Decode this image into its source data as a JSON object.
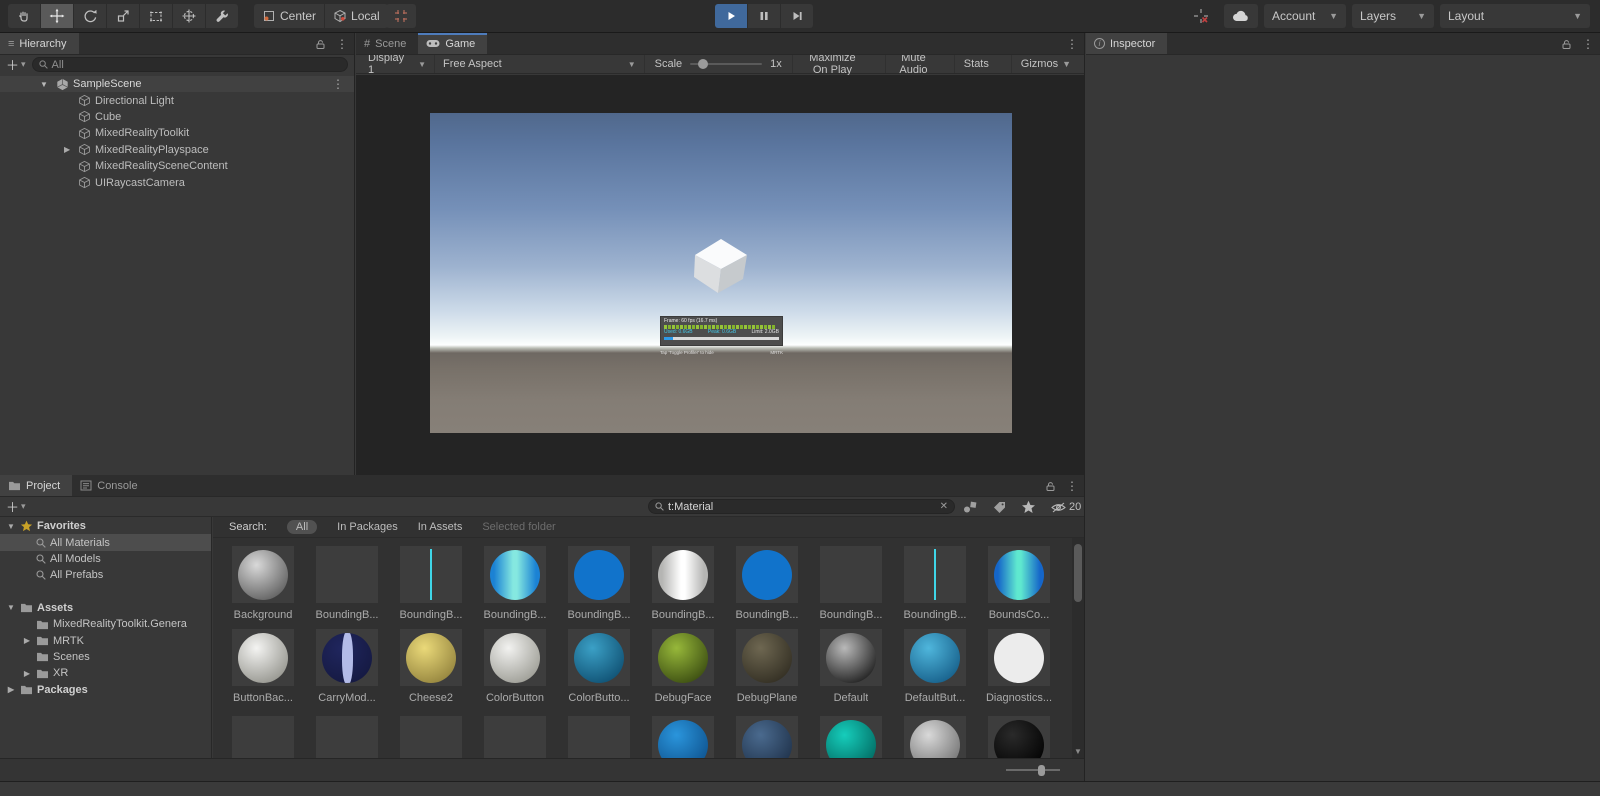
{
  "topbar": {
    "pivot": "Center",
    "space": "Local",
    "account": "Account",
    "layers": "Layers",
    "layout": "Layout"
  },
  "hierarchy": {
    "title": "Hierarchy",
    "search_placeholder": "All",
    "scene_name": "SampleScene",
    "items": [
      {
        "label": "Directional Light",
        "expandable": false
      },
      {
        "label": "Cube",
        "expandable": false
      },
      {
        "label": "MixedRealityToolkit",
        "expandable": false
      },
      {
        "label": "MixedRealityPlayspace",
        "expandable": true
      },
      {
        "label": "MixedRealitySceneContent",
        "expandable": false
      },
      {
        "label": "UIRaycastCamera",
        "expandable": false
      }
    ]
  },
  "game": {
    "scene_tab": "Scene",
    "game_tab": "Game",
    "display": "Display 1",
    "aspect": "Free Aspect",
    "scale_label": "Scale",
    "scale_value": "1x",
    "buttons": [
      {
        "label": "Maximize On Play",
        "dropdown": false
      },
      {
        "label": "Mute Audio",
        "dropdown": false
      },
      {
        "label": "Stats",
        "dropdown": false
      },
      {
        "label": "Gizmos",
        "dropdown": true
      }
    ],
    "profiler": {
      "title": "Frame: 60 fps (16.7 ms)",
      "used_label": "Used: 0.6GB",
      "peak_label": "Peak: 0.6GB",
      "limit_label": "Limit: 2.0GB",
      "caption_left": "Tap 'Toggle Profiler' to hide",
      "caption_right": "MRTK"
    }
  },
  "inspector": {
    "title": "Inspector"
  },
  "project": {
    "project_tab": "Project",
    "console_tab": "Console",
    "search_value": "t:Material",
    "hidden_count": "20",
    "filter_label": "Search:",
    "scopes": [
      {
        "label": "All",
        "active": true,
        "disabled": false
      },
      {
        "label": "In Packages",
        "active": false,
        "disabled": false
      },
      {
        "label": "In Assets",
        "active": false,
        "disabled": false
      },
      {
        "label": "Selected folder",
        "active": false,
        "disabled": true
      }
    ],
    "favorites_label": "Favorites",
    "favorites": [
      {
        "label": "All Materials",
        "selected": true
      },
      {
        "label": "All Models",
        "selected": false
      },
      {
        "label": "All Prefabs",
        "selected": false
      }
    ],
    "assets_label": "Assets",
    "asset_folders": [
      {
        "label": "MixedRealityToolkit.Genera",
        "expandable": false
      },
      {
        "label": "MRTK",
        "expandable": true
      },
      {
        "label": "Scenes",
        "expandable": false
      },
      {
        "label": "XR",
        "expandable": true
      }
    ],
    "packages_label": "Packages",
    "material_rows": [
      [
        {
          "label": "Background",
          "kind": "sphere",
          "c1": "#d9d9d9",
          "c2": "#585858"
        },
        {
          "label": "BoundingB...",
          "kind": "empty",
          "c1": "",
          "c2": ""
        },
        {
          "label": "BoundingB...",
          "kind": "vline",
          "c1": "#3fd6e8",
          "c2": ""
        },
        {
          "label": "BoundingB...",
          "kind": "hstripe",
          "c1": "#1b82d4",
          "c2": "#85e8e0"
        },
        {
          "label": "BoundingB...",
          "kind": "flat",
          "c1": "#1173cb",
          "c2": ""
        },
        {
          "label": "BoundingB...",
          "kind": "hstripe",
          "c1": "#b5b5b3",
          "c2": "#ffffff"
        },
        {
          "label": "BoundingB...",
          "kind": "flat",
          "c1": "#1173cb",
          "c2": ""
        },
        {
          "label": "BoundingB...",
          "kind": "empty",
          "c1": "",
          "c2": ""
        },
        {
          "label": "BoundingB...",
          "kind": "vline",
          "c1": "#3fd6e8",
          "c2": ""
        },
        {
          "label": "BoundsCo...",
          "kind": "hstripe",
          "c1": "#1566c9",
          "c2": "#5fe8cf"
        }
      ],
      [
        {
          "label": "ButtonBac...",
          "kind": "sphere",
          "c1": "#f4f4f2",
          "c2": "#8f8f88"
        },
        {
          "label": "CarryMod...",
          "kind": "carry",
          "c1": "#20265e",
          "c2": "#b3bbe8"
        },
        {
          "label": "Cheese2",
          "kind": "sphere",
          "c1": "#ead979",
          "c2": "#8f7f3a"
        },
        {
          "label": "ColorButton",
          "kind": "sphere",
          "c1": "#f2f2f0",
          "c2": "#97978f"
        },
        {
          "label": "ColorButto...",
          "kind": "sphere",
          "c1": "#3ba0c6",
          "c2": "#0d4c6e"
        },
        {
          "label": "DebugFace",
          "kind": "sphere",
          "c1": "#97b83a",
          "c2": "#36470f"
        },
        {
          "label": "DebugPlane",
          "kind": "sphere",
          "c1": "#6e6751",
          "c2": "#2f2b20"
        },
        {
          "label": "Default",
          "kind": "sphere",
          "c1": "#b9b9b9",
          "c2": "#161616"
        },
        {
          "label": "DefaultBut...",
          "kind": "sphere",
          "c1": "#4fb6dc",
          "c2": "#135a85"
        },
        {
          "label": "Diagnostics...",
          "kind": "flat",
          "c1": "#ececec",
          "c2": ""
        }
      ],
      [
        {
          "label": "",
          "kind": "empty",
          "c1": "",
          "c2": ""
        },
        {
          "label": "",
          "kind": "empty",
          "c1": "",
          "c2": ""
        },
        {
          "label": "",
          "kind": "empty",
          "c1": "",
          "c2": ""
        },
        {
          "label": "",
          "kind": "empty",
          "c1": "",
          "c2": ""
        },
        {
          "label": "",
          "kind": "empty",
          "c1": "",
          "c2": ""
        },
        {
          "label": "",
          "kind": "sphere",
          "c1": "#2a95dc",
          "c2": "#0d4f8a"
        },
        {
          "label": "",
          "kind": "sphere",
          "c1": "#4a6a8e",
          "c2": "#1d2f47"
        },
        {
          "label": "",
          "kind": "sphere",
          "c1": "#16cdbb",
          "c2": "#00645c"
        },
        {
          "label": "",
          "kind": "sphere",
          "c1": "#d9d9d9",
          "c2": "#6e6e6e"
        },
        {
          "label": "",
          "kind": "sphere",
          "c1": "#2a2a2a",
          "c2": "#000000"
        }
      ]
    ]
  }
}
